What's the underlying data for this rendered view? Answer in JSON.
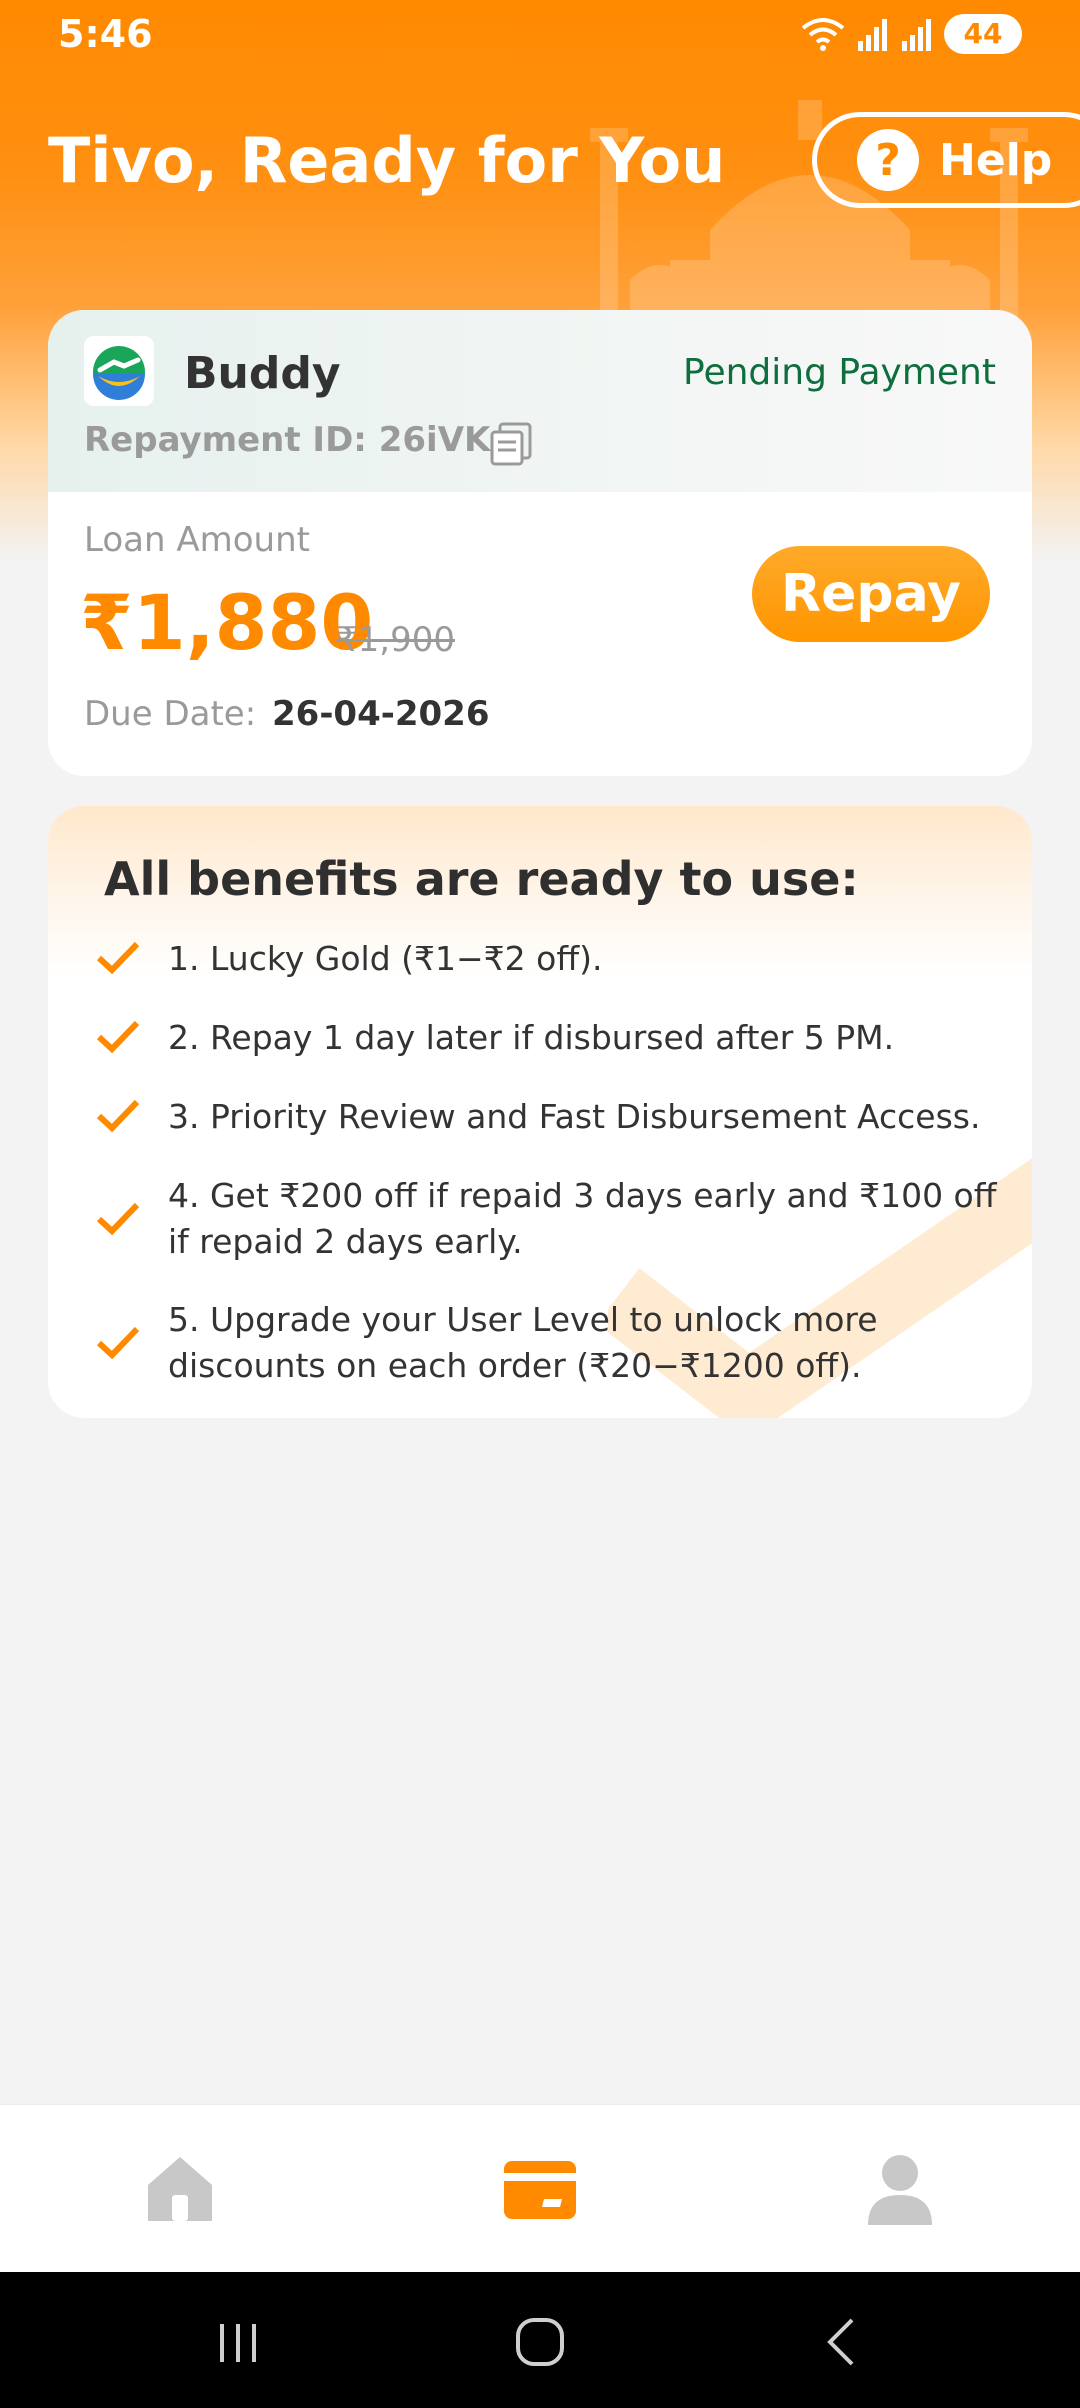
{
  "status_bar": {
    "time": "5:46",
    "battery": "44"
  },
  "header": {
    "title": "Tivo, Ready for You",
    "help_label": "Help"
  },
  "loan_card": {
    "app_name": "Buddy",
    "status": "Pending Payment",
    "repayment_id_label": "Repayment ID: 26iVKa",
    "amount_label": "Loan Amount",
    "amount": "₹1,880",
    "original_amount": "₹1,900",
    "due_date_label": "Due Date:",
    "due_date": "26-04-2026",
    "repay_label": "Repay"
  },
  "benefits": {
    "title": "All benefits are ready to use:",
    "items": [
      "1. Lucky Gold (₹1−₹2 off).",
      "2. Repay 1 day later if disbursed after 5 PM.",
      "3. Priority Review and Fast Disbursement Access.",
      "4. Get ₹200 off if repaid 3 days early and ₹100 off if repaid 2 days early.",
      "5. Upgrade your User Level to unlock more discounts on each order (₹20−₹1200 off)."
    ]
  },
  "bottom_nav": {
    "items": [
      "home-icon",
      "card-icon",
      "profile-icon"
    ],
    "active": "card-icon"
  },
  "colors": {
    "accent": "#ff8a00",
    "status_green": "#0f6e3e"
  }
}
